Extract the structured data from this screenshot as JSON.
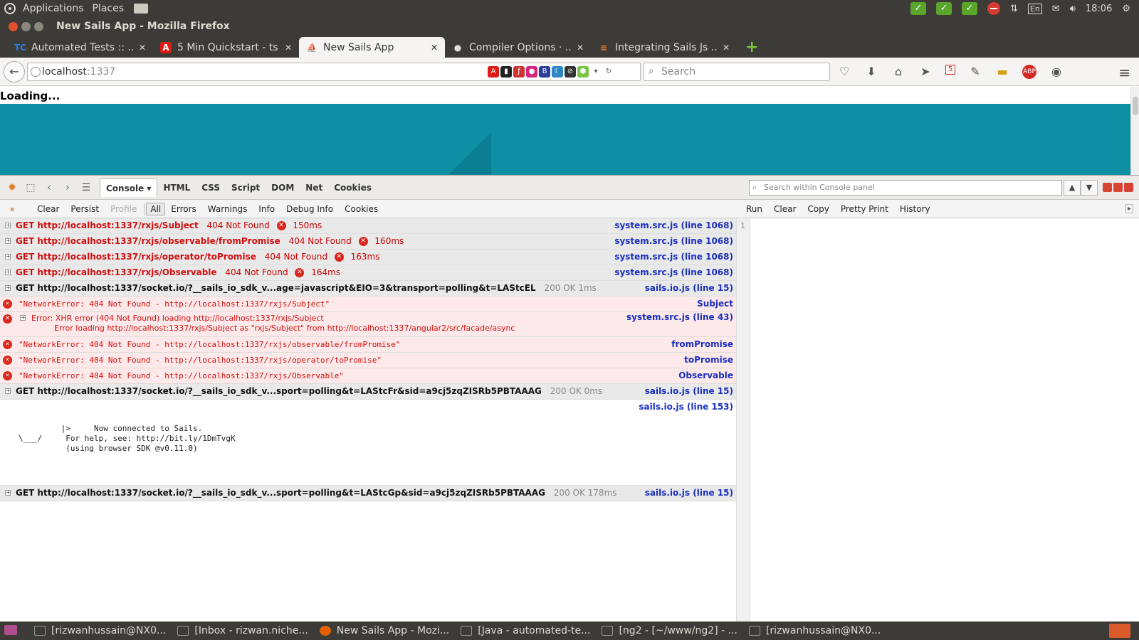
{
  "os_panel": {
    "menus": [
      "Applications",
      "Places"
    ],
    "time": "18:06",
    "keyboard": "En"
  },
  "window": {
    "title": "New Sails App - Mozilla Firefox"
  },
  "tabs": [
    {
      "label": "Automated Tests :: ...",
      "icon": "teamcity-icon",
      "icon_text": "TC",
      "icon_color": "#2b7fe0"
    },
    {
      "label": "5 Min Quickstart - ts",
      "icon": "angular-icon",
      "icon_text": "A",
      "icon_color": "#dd1b16"
    },
    {
      "label": "New Sails App",
      "icon": "sails-icon",
      "icon_text": "⛵",
      "icon_color": "#14acc2",
      "active": true
    },
    {
      "label": "Compiler Options · ...",
      "icon": "github-icon",
      "icon_text": "●",
      "icon_color": "#333333"
    },
    {
      "label": "Integrating Sails Js ...",
      "icon": "stackoverflow-icon",
      "icon_text": "≡",
      "icon_color": "#f48024"
    }
  ],
  "navbar": {
    "url_host": "localhost",
    "url_port": ":1337",
    "search_placeholder": "Search",
    "badge": "5"
  },
  "page": {
    "loading_text": "Loading..."
  },
  "firebug": {
    "tabs": [
      "Console",
      "HTML",
      "CSS",
      "Script",
      "DOM",
      "Net",
      "Cookies"
    ],
    "search_placeholder": "Search within Console panel",
    "filters": {
      "clear": "Clear",
      "persist": "Persist",
      "profile": "Profile",
      "all": "All",
      "errors": "Errors",
      "warnings": "Warnings",
      "info": "Info",
      "debug": "Debug Info",
      "cookies": "Cookies"
    },
    "editor_actions": {
      "run": "Run",
      "clear": "Clear",
      "copy": "Copy",
      "pretty": "Pretty Print",
      "history": "History"
    },
    "line_number": "1"
  },
  "log": {
    "net1": {
      "url": "GET http://localhost:1337/rxjs/Subject",
      "status": "404 Not Found",
      "time": "150ms",
      "src": "system.src.js (line 1068)"
    },
    "net2": {
      "url": "GET http://localhost:1337/rxjs/observable/fromPromise",
      "status": "404 Not Found",
      "time": "160ms",
      "src": "system.src.js (line 1068)"
    },
    "net3": {
      "url": "GET http://localhost:1337/rxjs/operator/toPromise",
      "status": "404 Not Found",
      "time": "163ms",
      "src": "system.src.js (line 1068)"
    },
    "net4": {
      "url": "GET http://localhost:1337/rxjs/Observable",
      "status": "404 Not Found",
      "time": "164ms",
      "src": "system.src.js (line 1068)"
    },
    "net5": {
      "url": "GET http://localhost:1337/socket.io/?__sails_io_sdk_v...age=javascript&EIO=3&transport=polling&t=LAStcEL",
      "status": "200 OK 1ms",
      "src": "sails.io.js (line 15)"
    },
    "err1": {
      "text": "\"NetworkError: 404 Not Found - http://localhost:1337/rxjs/Subject\"",
      "src": "Subject"
    },
    "err2": {
      "line1": "Error: XHR error (404 Not Found) loading http://localhost:1337/rxjs/Subject",
      "line2": "Error loading http://localhost:1337/rxjs/Subject as \"rxjs/Subject\" from http://localhost:1337/angular2/src/facade/async",
      "src": "system.src.js (line 43)"
    },
    "err3": {
      "text": "\"NetworkError: 404 Not Found - http://localhost:1337/rxjs/observable/fromPromise\"",
      "src": "fromPromise"
    },
    "err4": {
      "text": "\"NetworkError: 404 Not Found - http://localhost:1337/rxjs/operator/toPromise\"",
      "src": "toPromise"
    },
    "err5": {
      "text": "\"NetworkError: 404 Not Found - http://localhost:1337/rxjs/Observable\"",
      "src": "Observable"
    },
    "net6": {
      "url": "GET http://localhost:1337/socket.io/?__sails_io_sdk_v...sport=polling&t=LAStcFr&sid=a9cj5zqZISRb5PBTAAAG",
      "status": "200 OK 0ms",
      "src": "sails.io.js (line 15)"
    },
    "info": {
      "text": "   |>     Now connected to Sails.\n\\___/     For help, see: http://bit.ly/1DmTvgK\n          (using browser SDK @v0.11.0)",
      "src": "sails.io.js (line 153)"
    },
    "net7": {
      "url": "GET http://localhost:1337/socket.io/?__sails_io_sdk_v...sport=polling&t=LAStcGp&sid=a9cj5zqZISRb5PBTAAAG",
      "status": "200 OK 178ms",
      "src": "sails.io.js (line 15)"
    }
  },
  "taskbar": [
    {
      "label": "[rizwanhussain@NX0...",
      "icon": "terminal-icon"
    },
    {
      "label": "[Inbox - rizwan.niche...",
      "icon": "mail-icon"
    },
    {
      "label": "New Sails App - Mozi...",
      "icon": "firefox-icon"
    },
    {
      "label": "[Java - automated-te...",
      "icon": "eclipse-icon"
    },
    {
      "label": "[ng2 - [~/www/ng2] - ...",
      "icon": "ide-icon"
    },
    {
      "label": "[rizwanhussain@NX0...",
      "icon": "terminal-icon"
    }
  ]
}
